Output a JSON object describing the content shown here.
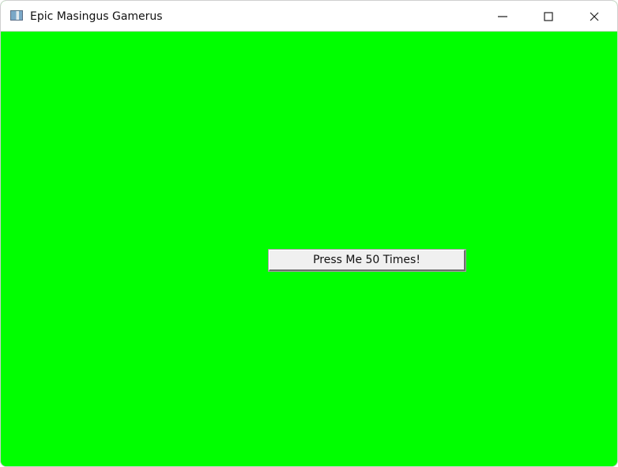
{
  "window": {
    "title": "Epic Masingus Gamerus",
    "background_color": "#00ff00",
    "icons": {
      "app": "app-window-icon",
      "minimize": "minimize-icon",
      "maximize": "maximize-icon",
      "close": "close-icon"
    }
  },
  "main": {
    "button_label": "Press Me 50 Times!"
  }
}
